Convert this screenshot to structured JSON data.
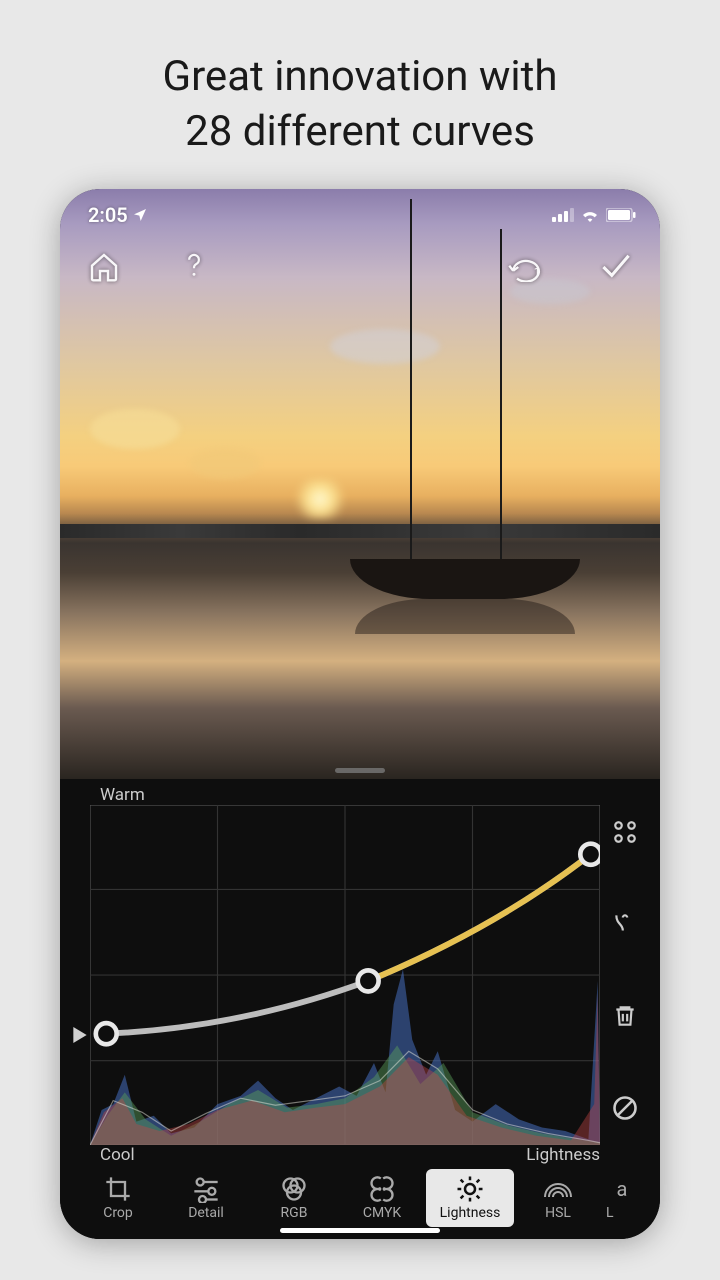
{
  "promo": {
    "line1": "Great innovation with",
    "line2": "28 different curves"
  },
  "status": {
    "time": "2:05"
  },
  "curve": {
    "top_label": "Warm",
    "bottom_left": "Cool",
    "bottom_right": "Lightness"
  },
  "tabs": [
    {
      "label": "Crop",
      "icon": "crop-icon",
      "active": false
    },
    {
      "label": "Detail",
      "icon": "detail-icon",
      "active": false
    },
    {
      "label": "RGB",
      "icon": "rgb-icon",
      "active": false
    },
    {
      "label": "CMYK",
      "icon": "cmyk-icon",
      "active": false
    },
    {
      "label": "Lightness",
      "icon": "brightness-icon",
      "active": true
    },
    {
      "label": "HSL",
      "icon": "hsl-icon",
      "active": false
    }
  ],
  "partial_tab": {
    "label": "a"
  }
}
